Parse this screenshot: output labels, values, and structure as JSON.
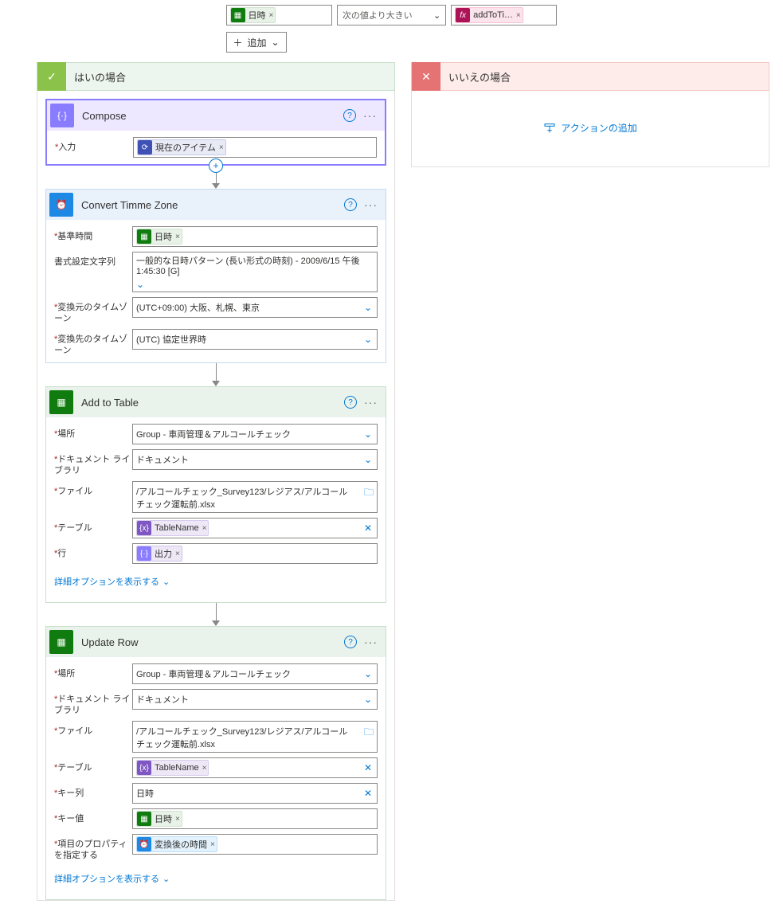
{
  "condition": {
    "left_token": "日時",
    "operator": "次の値より大きい",
    "right_token": "addToTi…",
    "add_row": "追加"
  },
  "yes_branch": {
    "title": "はいの場合"
  },
  "no_branch": {
    "title": "いいえの場合",
    "add_action": "アクションの追加"
  },
  "compose": {
    "title": "Compose",
    "input_label": "入力",
    "token": "現在のアイテム"
  },
  "ctz": {
    "title": "Convert Timme Zone",
    "base_label": "基準時間",
    "base_token": "日時",
    "fmt_label": "書式設定文字列",
    "fmt_value": "一般的な日時パターン (長い形式の時刻) - 2009/6/15 午後 1:45:30 [G]",
    "src_label": "変換元のタイムゾーン",
    "src_value": "(UTC+09:00) 大阪、札幌、東京",
    "dst_label": "変換先のタイムゾーン",
    "dst_value": "(UTC) 協定世界時"
  },
  "add_table": {
    "title": "Add to Table",
    "loc_label": "場所",
    "loc_value": "Group - 車両管理＆アルコールチェック",
    "lib_label": "ドキュメント ライブラリ",
    "lib_value": "ドキュメント",
    "file_label": "ファイル",
    "file_value": "/アルコールチェック_Survey123/レジアス/アルコールチェック運転前.xlsx",
    "table_label": "テーブル",
    "table_token": "TableName",
    "row_label": "行",
    "row_token": "出力",
    "adv": "詳細オプションを表示する"
  },
  "update_row": {
    "title": "Update Row",
    "loc_label": "場所",
    "loc_value": "Group - 車両管理＆アルコールチェック",
    "lib_label": "ドキュメント ライブラリ",
    "lib_value": "ドキュメント",
    "file_label": "ファイル",
    "file_value": "/アルコールチェック_Survey123/レジアス/アルコールチェック運転前.xlsx",
    "table_label": "テーブル",
    "table_token": "TableName",
    "keycol_label": "キー列",
    "keycol_value": "日時",
    "keyval_label": "キー値",
    "keyval_token": "日時",
    "prop_label": "項目のプロパティを指定する",
    "prop_token": "変換後の時間",
    "adv": "詳細オプションを表示する"
  }
}
